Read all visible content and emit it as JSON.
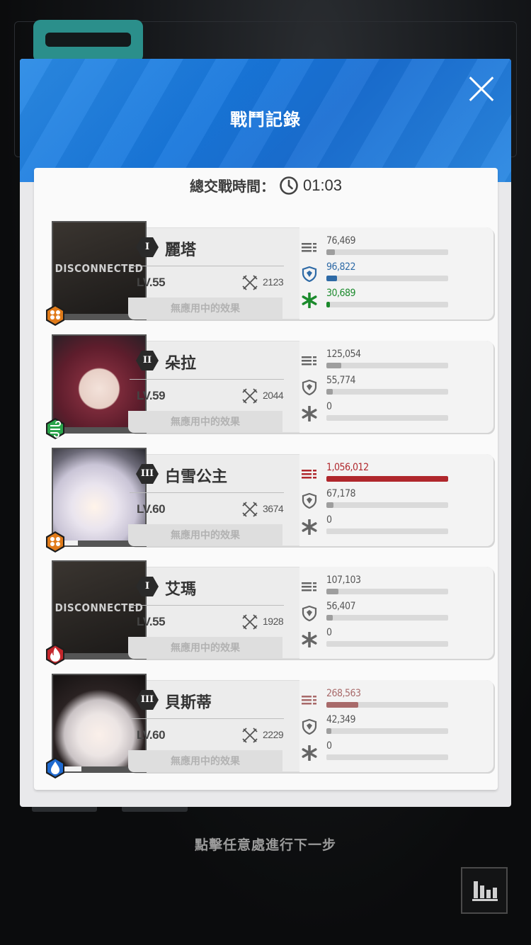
{
  "dialog": {
    "title": "戰鬥記錄",
    "total_time_label": "總交戰時間：",
    "total_time": "01:03"
  },
  "colors": {
    "header_blue": "#1a77dc",
    "damage_gray": "#9e9e9e",
    "damage_red": "#b0272c",
    "damage_light_red": "#a86a6a",
    "shield_blue": "#2e6aa6",
    "heal_green": "#1b8a2c"
  },
  "units": [
    {
      "rank": "I",
      "name": "麗塔",
      "level": "LV.55",
      "power": "2123",
      "status": "DISCONNECTED",
      "effect": "無應用中的效果",
      "element_icon": "honeycomb-icon",
      "element_color": "#e07b1a",
      "hp_fraction": 0,
      "damage": "76,469",
      "damage_fraction": 0.07,
      "damage_color": "#9e9e9e",
      "shield": "96,822",
      "shield_fraction": 0.09,
      "shield_color": "#2e6aa6",
      "heal": "30,689",
      "heal_fraction": 0.03,
      "heal_color": "#1b8a2c"
    },
    {
      "rank": "II",
      "name": "朵拉",
      "level": "LV.59",
      "power": "2044",
      "status": "",
      "effect": "無應用中的效果",
      "element_icon": "wind-icon",
      "element_color": "#2aa34a",
      "hp_fraction": 0,
      "damage": "125,054",
      "damage_fraction": 0.12,
      "damage_color": "#9e9e9e",
      "shield": "55,774",
      "shield_fraction": 0.05,
      "shield_color": "#9e9e9e",
      "heal": "0",
      "heal_fraction": 0,
      "heal_color": "#9e9e9e"
    },
    {
      "rank": "III",
      "name": "白雪公主",
      "level": "LV.60",
      "power": "3674",
      "status": "",
      "effect": "無應用中的效果",
      "element_icon": "honeycomb-icon",
      "element_color": "#e07b1a",
      "hp_fraction": 0.18,
      "damage": "1,056,012",
      "damage_fraction": 1,
      "damage_color": "#b0272c",
      "shield": "67,178",
      "shield_fraction": 0.06,
      "shield_color": "#9e9e9e",
      "heal": "0",
      "heal_fraction": 0,
      "heal_color": "#9e9e9e"
    },
    {
      "rank": "I",
      "name": "艾瑪",
      "level": "LV.55",
      "power": "1928",
      "status": "DISCONNECTED",
      "effect": "無應用中的效果",
      "element_icon": "fire-icon",
      "element_color": "#c4272c",
      "hp_fraction": 0,
      "damage": "107,103",
      "damage_fraction": 0.1,
      "damage_color": "#9e9e9e",
      "shield": "56,407",
      "shield_fraction": 0.05,
      "shield_color": "#9e9e9e",
      "heal": "0",
      "heal_fraction": 0,
      "heal_color": "#9e9e9e"
    },
    {
      "rank": "III",
      "name": "貝斯蒂",
      "level": "LV.60",
      "power": "2229",
      "status": "",
      "effect": "無應用中的效果",
      "element_icon": "water-icon",
      "element_color": "#1f6ad0",
      "hp_fraction": 0.22,
      "damage": "268,563",
      "damage_fraction": 0.26,
      "damage_color": "#a86a6a",
      "shield": "42,349",
      "shield_fraction": 0.04,
      "shield_color": "#9e9e9e",
      "heal": "0",
      "heal_fraction": 0,
      "heal_color": "#9e9e9e"
    }
  ],
  "footer": {
    "hint": "點擊任意處進行下一步",
    "stats_button_icon": "bar-chart-icon"
  }
}
